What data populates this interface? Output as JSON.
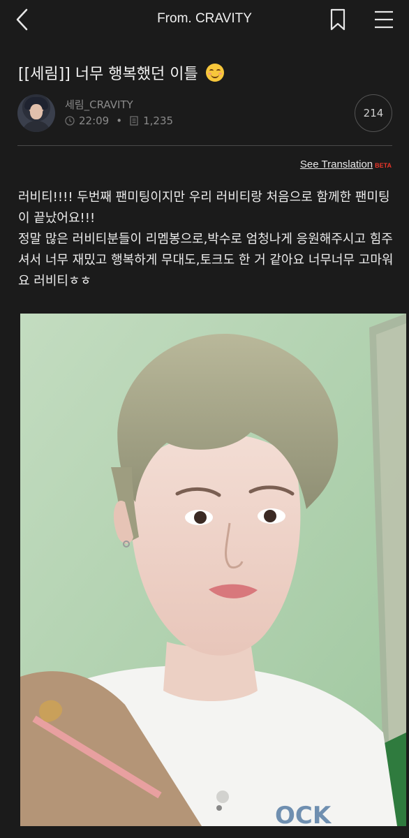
{
  "header": {
    "title": "From. CRAVITY"
  },
  "post": {
    "title": "[[세림]] 너무 행복했던 이틀",
    "author": "세림_CRAVITY",
    "time": "22:09",
    "views": "1,235",
    "comment_count": "214",
    "translate_label": "See Translation",
    "beta_label": "BETA",
    "body_paragraphs": [
      "러비티!!!! 두번째 팬미팅이지만 우리 러비티랑 처음으로 함께한 팬미팅이 끝났어요!!!",
      "정말 많은 러비티분들이 리멤봉으로,박수로 엄청나게 응원해주시고 힘주셔서 너무 재밌고 행복하게 무대도,토크도 한 거 같아요 너무너무 고마워요 러비티ㅎㅎ"
    ]
  },
  "photo": {
    "shirt_text": "OCK"
  },
  "icons": {
    "back": "chevron-left-icon",
    "bookmark": "bookmark-icon",
    "menu": "menu-icon",
    "clock": "clock-icon",
    "views": "document-icon",
    "emoji": "smiling-face-emoji"
  }
}
